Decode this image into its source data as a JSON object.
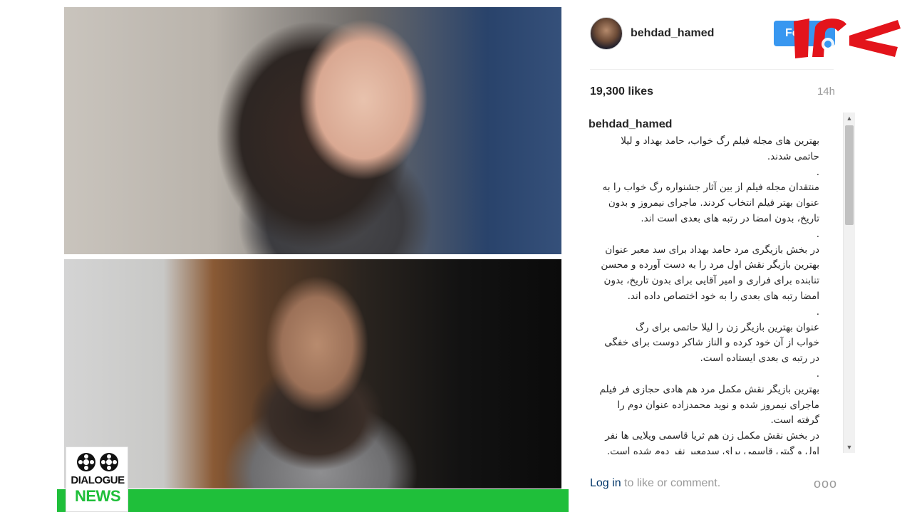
{
  "media": {
    "logo": {
      "line1": "DIALOGUE",
      "line2": "NEWS"
    }
  },
  "post": {
    "username": "behdad_hamed",
    "follow_label": "Fo",
    "likes": "19,300 likes",
    "time_ago": "14h",
    "caption": {
      "username": "behdad_hamed",
      "separator": ".",
      "lines": [
        "بهترین های مجله فیلم رگ خواب، حامد بهداد و لیلا",
        "حاتمی شدند.",
        ".",
        "منتقدان مجله فیلم از بین آثار جشنواره رگ خواب را به",
        "عنوان بهتر فیلم انتخاب کردند. ماجرای نیمروز و بدون",
        "تاریخ، بدون امضا در رتبه های بعدی است اند.",
        ".",
        "در بخش بازیگری مرد حامد بهداد برای سد معبر عنوان",
        "بهترین بازیگر نقش اول مرد را به دست آورده و محسن",
        "تنابنده برای فراری و امیر آقایی برای بدون تاریخ، بدون",
        "امضا رتبه های بعدی را به خود اختصاص داده اند.",
        ".",
        "عنوان بهترین بازیگر زن را لیلا حاتمی برای رگ",
        "خواب از آن خود کرده و الناز شاکر دوست برای خفگی",
        "در رتبه ی بعدی ایستاده است.",
        ".",
        "بهترین بازیگر نقش مکمل مرد هم هادی حجازی فر فیلم",
        "ماجرای نیمروز شده و نوید محمدزاده عنوان دوم را",
        "گرفته است.",
        "در بخش نقش مکمل زن هم ثریا قاسمی ویلایی ها نفر",
        "اول و گیتی قاسمی برای سدمعبر نفر دوم شده است."
      ]
    },
    "login_link": "Log in",
    "login_rest": " to like or comment.",
    "more_label": "ooo"
  },
  "colors": {
    "follow_bg": "#3897f0",
    "green_bar": "#1fbf3a",
    "watermark_red": "#e3141b"
  },
  "icons": {
    "more": "ellipsis-icon",
    "watermark": "rokna-logo"
  }
}
